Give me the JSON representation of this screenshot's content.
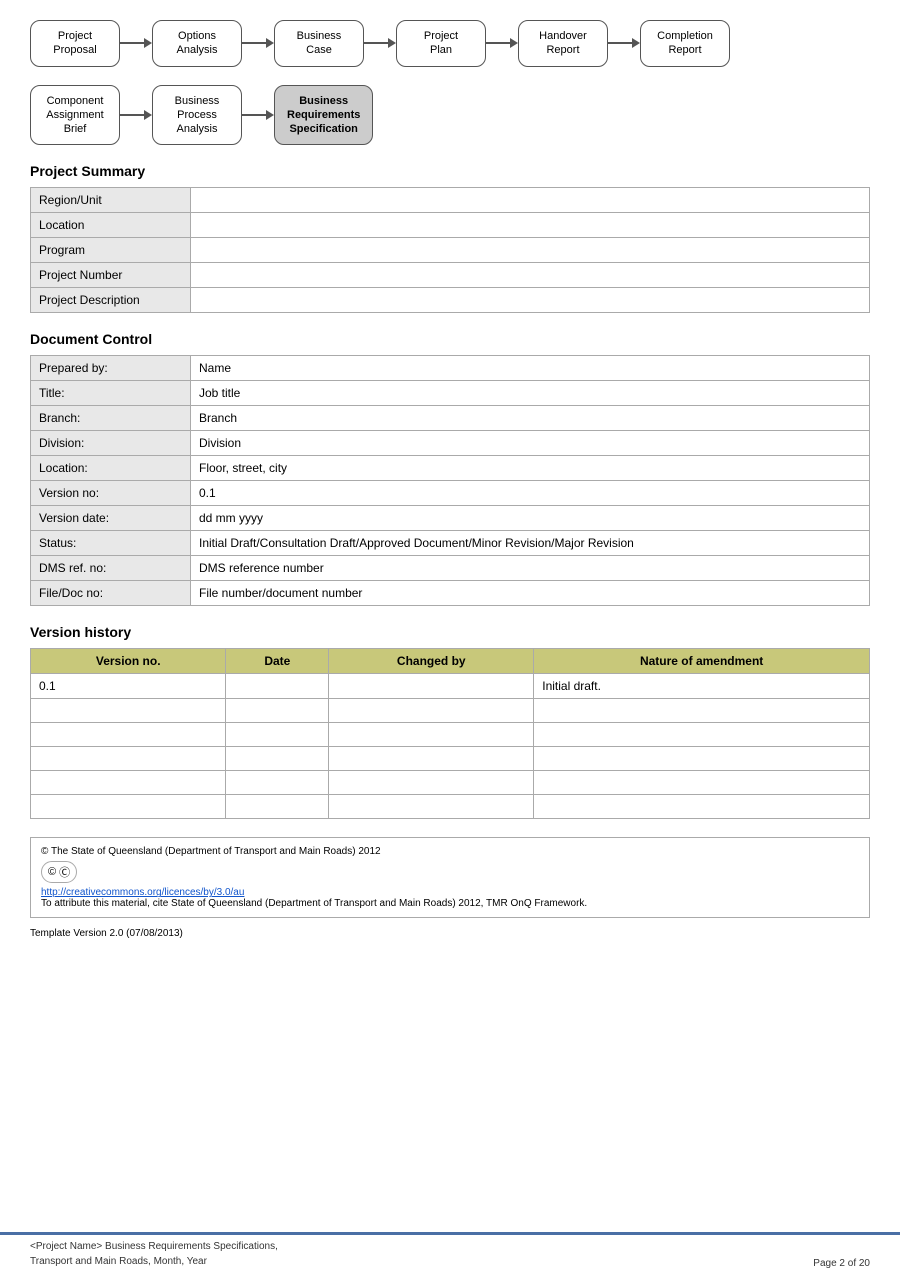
{
  "flow1": {
    "nodes": [
      {
        "label": "Project\nProposal",
        "highlighted": false
      },
      {
        "label": "Options\nAnalysis",
        "highlighted": false
      },
      {
        "label": "Business\nCase",
        "highlighted": false
      },
      {
        "label": "Project\nPlan",
        "highlighted": false
      },
      {
        "label": "Handover\nReport",
        "highlighted": false
      },
      {
        "label": "Completion\nReport",
        "highlighted": false
      }
    ]
  },
  "flow2": {
    "nodes": [
      {
        "label": "Component\nAssignment\nBrief",
        "highlighted": false
      },
      {
        "label": "Business\nProcess\nAnalysis",
        "highlighted": false
      },
      {
        "label": "Business\nRequirements\nSpecification",
        "highlighted": true
      }
    ]
  },
  "projectSummary": {
    "title": "Project Summary",
    "rows": [
      {
        "label": "Region/Unit",
        "value": ""
      },
      {
        "label": "Location",
        "value": ""
      },
      {
        "label": "Program",
        "value": ""
      },
      {
        "label": "Project Number",
        "value": ""
      },
      {
        "label": "Project Description",
        "value": ""
      }
    ]
  },
  "documentControl": {
    "title": "Document Control",
    "rows": [
      {
        "label": "Prepared by:",
        "value": "Name"
      },
      {
        "label": "Title:",
        "value": "Job title"
      },
      {
        "label": "Branch:",
        "value": "Branch"
      },
      {
        "label": "Division:",
        "value": "Division"
      },
      {
        "label": "Location:",
        "value": "Floor, street, city"
      },
      {
        "label": "Version no:",
        "value": "0.1"
      },
      {
        "label": "Version date:",
        "value": "dd mm yyyy"
      },
      {
        "label": "Status:",
        "value": "Initial Draft/Consultation Draft/Approved Document/Minor Revision/Major Revision"
      },
      {
        "label": "DMS ref. no:",
        "value": "DMS reference number"
      },
      {
        "label": "File/Doc no:",
        "value": "File number/document number"
      }
    ]
  },
  "versionHistory": {
    "title": "Version history",
    "headers": [
      "Version no.",
      "Date",
      "Changed by",
      "Nature of amendment"
    ],
    "rows": [
      {
        "version": "0.1",
        "date": "",
        "changedBy": "",
        "nature": "Initial draft."
      },
      {
        "version": "",
        "date": "",
        "changedBy": "",
        "nature": ""
      },
      {
        "version": "",
        "date": "",
        "changedBy": "",
        "nature": ""
      },
      {
        "version": "",
        "date": "",
        "changedBy": "",
        "nature": ""
      },
      {
        "version": "",
        "date": "",
        "changedBy": "",
        "nature": ""
      },
      {
        "version": "",
        "date": "",
        "changedBy": "",
        "nature": ""
      }
    ]
  },
  "footer": {
    "copyright": "© The State of Queensland (Department of Transport and Main Roads) 2012",
    "ccLink": "http://creativecommons.org/licences/by/3.0/au",
    "attribution": "To attribute this material, cite State of Queensland (Department of Transport and Main Roads) 2012, TMR OnQ Framework.",
    "templateVersion": "Template Version 2.0 (07/08/2013)"
  },
  "pageBottom": {
    "leftLine1": "<Project Name> Business Requirements Specifications,",
    "leftLine2": "Transport and Main Roads, Month, Year",
    "rightText": "Page 2 of 20"
  }
}
